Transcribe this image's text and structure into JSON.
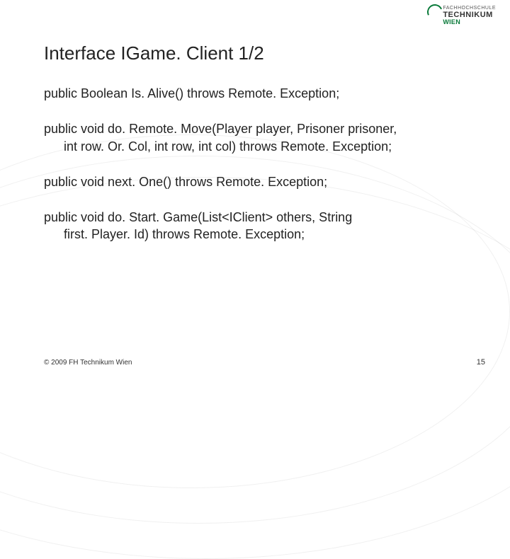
{
  "logo": {
    "line1": "FACHHOCHSCHULE",
    "line2": "TECHNIKUM",
    "line3": "WIEN"
  },
  "title": "Interface IGame. Client 1/2",
  "paragraphs": [
    {
      "line1": "public Boolean Is. Alive() throws Remote. Exception;",
      "line2": ""
    },
    {
      "line1": "public void do. Remote. Move(Player player, Prisoner prisoner,",
      "line2": "int row. Or. Col, int row, int col) throws Remote. Exception;"
    },
    {
      "line1": "public void next. One() throws Remote. Exception;",
      "line2": ""
    },
    {
      "line1": "public void do. Start. Game(List<IClient> others, String",
      "line2": "first. Player. Id) throws Remote. Exception;"
    }
  ],
  "footer": {
    "copyright": "© 2009 FH Technikum Wien",
    "page": "15"
  }
}
